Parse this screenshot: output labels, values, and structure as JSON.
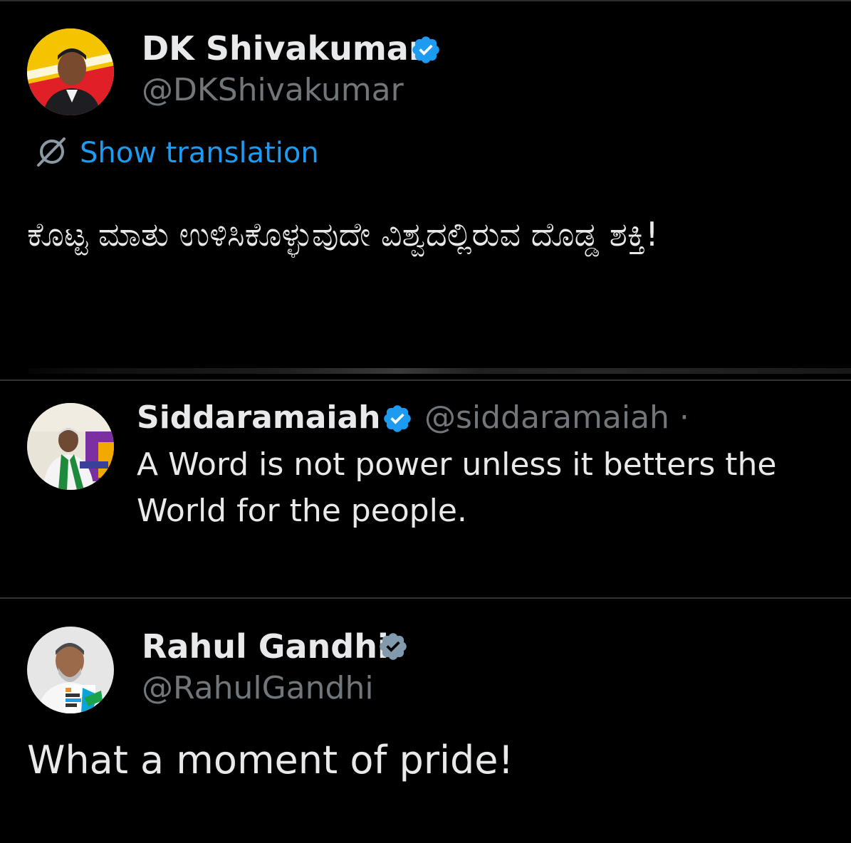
{
  "tweets": [
    {
      "name": "DK Shivakumar",
      "handle": "@DKShivakumar",
      "verified_badge": "verified-blue-check",
      "translate_icon": "globe-slash-icon",
      "translate_label": "Show translation",
      "text": "ಕೊಟ್ಟ ಮಾತು ಉಳಿಸಿಕೊಳ್ಳುವುದೇ ವಿಶ್ವದಲ್ಲಿರುವ ದೊಡ್ಡ ಶಕ್ತಿ!"
    },
    {
      "name": "Siddaramaiah",
      "handle": "@siddaramaiah ·",
      "verified_badge": "verified-blue-check",
      "text": "A Word is not power unless it betters the World for the people."
    },
    {
      "name": "Rahul Gandhi",
      "handle": "@RahulGandhi",
      "verified_badge": "verified-gray-check",
      "text": "What a moment of pride!"
    }
  ],
  "colors": {
    "background": "#000000",
    "primary_text": "#e7e9ea",
    "secondary_text": "#71767b",
    "link": "#1d9bf0",
    "verified_blue": "#1d9bf0",
    "verified_gray": "#829aab",
    "divider": "#2f3336"
  }
}
